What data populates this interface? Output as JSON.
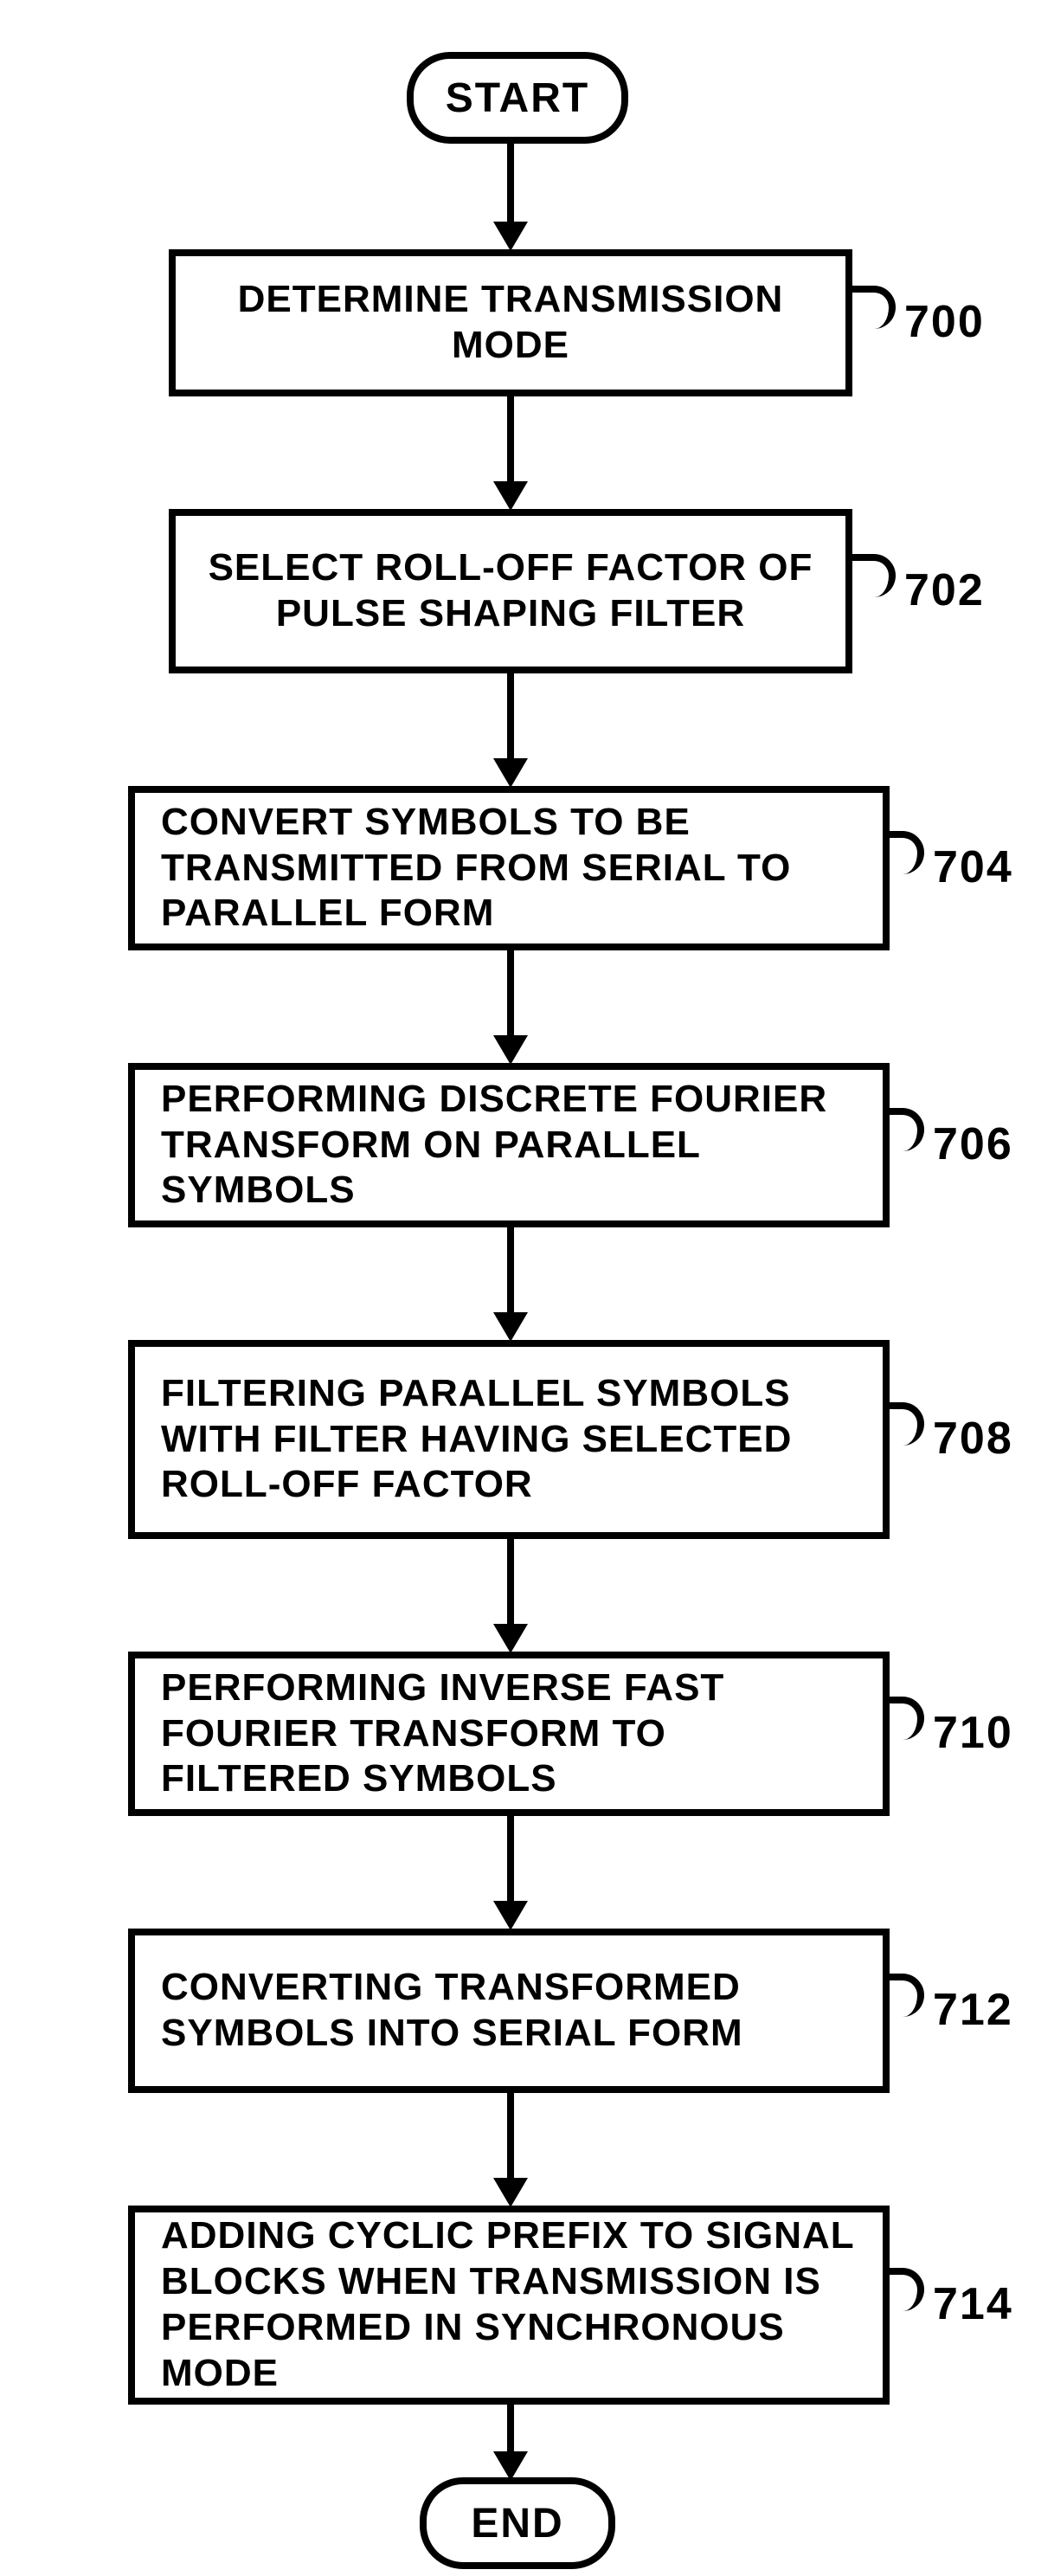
{
  "terminalStart": "START",
  "terminalEnd": "END",
  "steps": [
    {
      "text": "DETERMINE TRANSMISSION MODE",
      "ref": "700",
      "center": true
    },
    {
      "text": "SELECT ROLL-OFF FACTOR OF PULSE SHAPING FILTER",
      "ref": "702",
      "center": true
    },
    {
      "text": "CONVERT SYMBOLS TO BE TRANSMITTED FROM SERIAL TO PARALLEL FORM",
      "ref": "704",
      "center": false
    },
    {
      "text": "PERFORMING  DISCRETE FOURIER TRANSFORM ON  PARALLEL SYMBOLS",
      "ref": "706",
      "center": false
    },
    {
      "text": "FILTERING PARALLEL SYMBOLS WITH FILTER HAVING SELECTED ROLL-OFF FACTOR",
      "ref": "708",
      "center": false
    },
    {
      "text": "PERFORMING INVERSE FAST FOURIER TRANSFORM TO FILTERED SYMBOLS",
      "ref": "710",
      "center": false
    },
    {
      "text": "CONVERTING TRANSFORMED SYMBOLS INTO  SERIAL FORM",
      "ref": "712",
      "center": false
    },
    {
      "text": "ADDING CYCLIC PREFIX TO SIGNAL BLOCKS WHEN TRANSMISSION IS PERFORMED IN SYNCHRONOUS MODE",
      "ref": "714",
      "center": false
    }
  ]
}
